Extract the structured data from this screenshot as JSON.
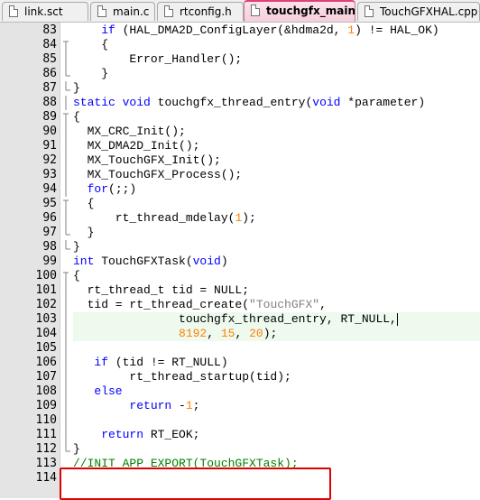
{
  "tabs": [
    {
      "label": "link.sct",
      "active": false
    },
    {
      "label": "main.c",
      "active": false
    },
    {
      "label": "rtconfig.h",
      "active": false
    },
    {
      "label": "touchgfx_main.c",
      "active": true
    },
    {
      "label": "TouchGFXHAL.cpp",
      "active": false
    }
  ],
  "colors": {
    "keyword": "#0000ff",
    "number": "#ff8000",
    "string": "#808080",
    "comment": "#008000",
    "highlight": "#eefaee",
    "annotation": "#e00000"
  },
  "lines": [
    {
      "num": "83",
      "text": "    if (HAL_DMA2D_ConfigLayer(&hdma2d, 1) != HAL_OK)"
    },
    {
      "num": "84",
      "text": "    {"
    },
    {
      "num": "85",
      "text": "        Error_Handler();"
    },
    {
      "num": "86",
      "text": "    }"
    },
    {
      "num": "87",
      "text": "}"
    },
    {
      "num": "88",
      "text": "static void touchgfx_thread_entry(void *parameter)"
    },
    {
      "num": "89",
      "text": "{"
    },
    {
      "num": "90",
      "text": "  MX_CRC_Init();"
    },
    {
      "num": "91",
      "text": "  MX_DMA2D_Init();"
    },
    {
      "num": "92",
      "text": "  MX_TouchGFX_Init();"
    },
    {
      "num": "93",
      "text": "  MX_TouchGFX_Process();"
    },
    {
      "num": "94",
      "text": "  for(;;)"
    },
    {
      "num": "95",
      "text": "  {"
    },
    {
      "num": "96",
      "text": "      rt_thread_mdelay(1);"
    },
    {
      "num": "97",
      "text": "  }"
    },
    {
      "num": "98",
      "text": "}"
    },
    {
      "num": "99",
      "text": "int TouchGFXTask(void)"
    },
    {
      "num": "100",
      "text": "{"
    },
    {
      "num": "101",
      "text": "  rt_thread_t tid = NULL;"
    },
    {
      "num": "102",
      "text": "  tid = rt_thread_create(\"TouchGFX\","
    },
    {
      "num": "103",
      "text": "               touchgfx_thread_entry, RT_NULL,"
    },
    {
      "num": "104",
      "text": "               8192, 15, 20);"
    },
    {
      "num": "105",
      "text": ""
    },
    {
      "num": "106",
      "text": "   if (tid != RT_NULL)"
    },
    {
      "num": "107",
      "text": "        rt_thread_startup(tid);"
    },
    {
      "num": "108",
      "text": "   else"
    },
    {
      "num": "109",
      "text": "        return -1;"
    },
    {
      "num": "110",
      "text": ""
    },
    {
      "num": "111",
      "text": "    return RT_EOK;"
    },
    {
      "num": "112",
      "text": "}"
    },
    {
      "num": "113",
      "text": "//INIT_APP_EXPORT(TouchGFXTask);"
    },
    {
      "num": "114",
      "text": ""
    }
  ]
}
